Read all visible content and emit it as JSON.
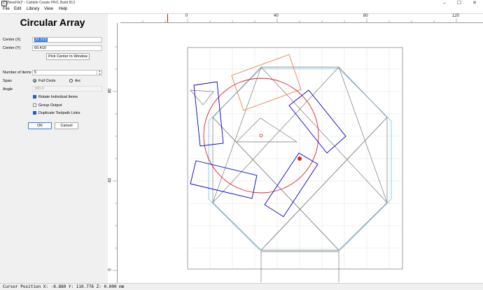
{
  "window": {
    "title": "[NewFile]* - Carbide Create PRO, Build 813",
    "minimize": "–",
    "maximize": "☐",
    "close": "✕"
  },
  "menu": [
    "File",
    "Edit",
    "Library",
    "View",
    "Help"
  ],
  "panel": {
    "title": "Circular Array",
    "center_x_label": "Center (X)",
    "center_x_value": "32.915",
    "center_y_label": "Center (Y)",
    "center_y_value": "60.410",
    "pick_center_label": "Pick Center In Window",
    "num_items_label": "Number of Items",
    "num_items_value": "5",
    "span_label": "Span",
    "span_full_circle": "Full Circle",
    "span_arc": "Arc",
    "span_selected": "full_circle",
    "angle_label": "Angle",
    "angle_value": "180.0",
    "rotate_label": "Rotate Individual Items",
    "rotate_checked": true,
    "group_label": "Group Output",
    "group_checked": false,
    "duplicate_label": "Duplicate Toolpath Links",
    "duplicate_checked": true,
    "ok_label": "OK",
    "cancel_label": "Cancel"
  },
  "ruler": {
    "x_ticks": [
      "0",
      "40",
      "80",
      "120"
    ],
    "y_ticks": [
      "80",
      "40",
      "0"
    ]
  },
  "status": {
    "cursor_position": "Cursor Position X: -8.880 Y: 110.776 Z: 0.000 mm"
  },
  "colors": {
    "selection_blue": "#0000cc",
    "circle_red": "#dd2222",
    "original_orange": "#e8742a",
    "outline_gray": "#7a7a7a",
    "outline_cyan": "#6ec8ee"
  }
}
